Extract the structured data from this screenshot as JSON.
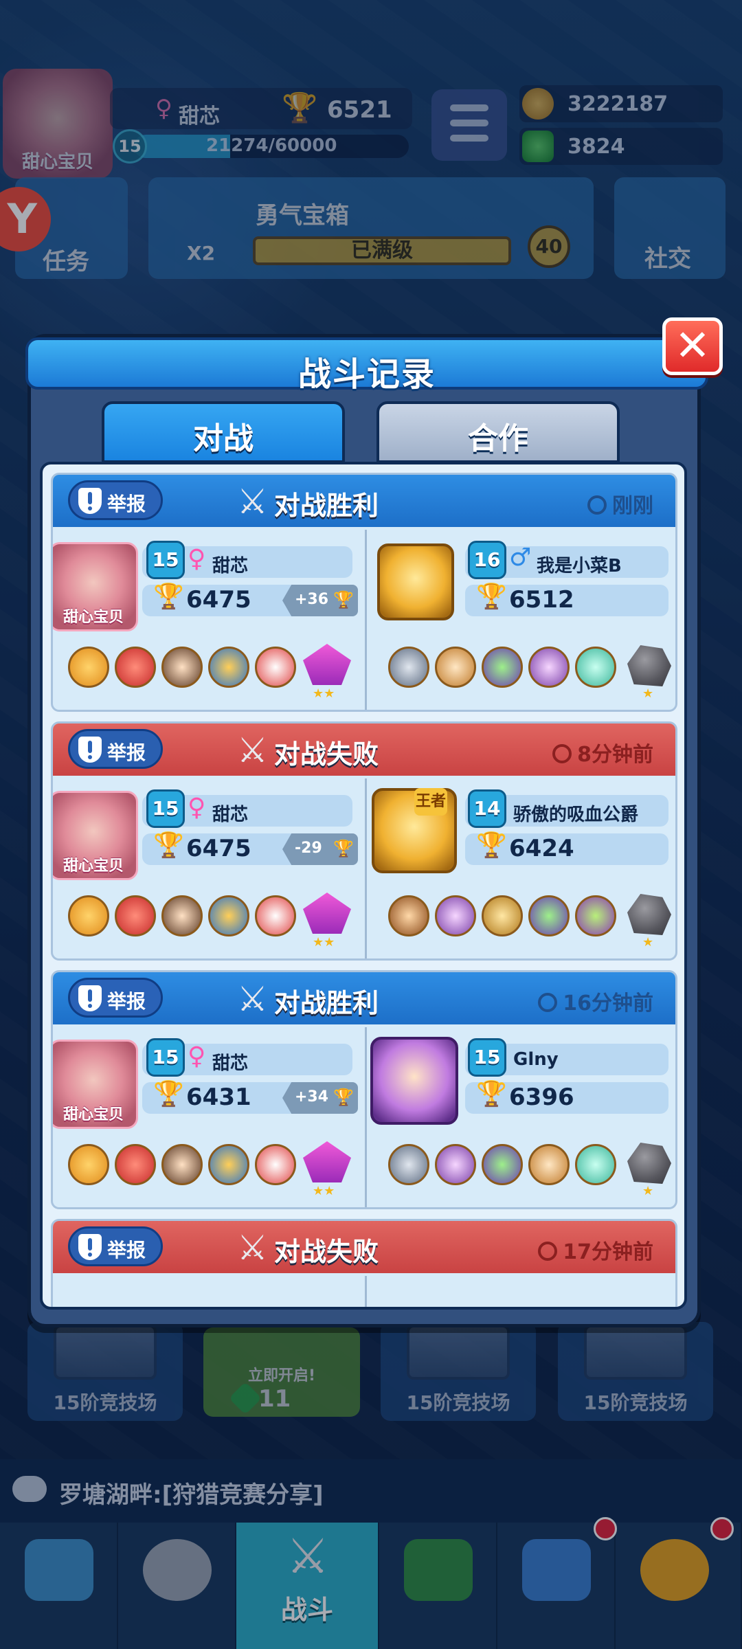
{
  "hud": {
    "avatar_tag": "甜心宝贝",
    "player_name": "甜芯",
    "trophies": "6521",
    "level": "15",
    "xp": "21274/60000",
    "gold": "3222187",
    "gems": "3824",
    "mission_label": "任务",
    "chest_title": "勇气宝箱",
    "chest_multiplier": "X2",
    "chest_status": "已满级",
    "chest_count": "40",
    "social_label": "社交",
    "logo": "Y"
  },
  "dialog": {
    "title": "战斗记录",
    "close_label": "✕",
    "tabs": [
      "对战",
      "合作"
    ]
  },
  "report_label": "举报",
  "records": [
    {
      "result": "对战胜利",
      "time": "刚刚",
      "me": {
        "avatar_tag": "甜心宝贝",
        "level": "15",
        "name": "甜芯",
        "score": "6475",
        "delta": "+36"
      },
      "opp": {
        "level": "16",
        "name": "我是小菜B",
        "score": "6512"
      }
    },
    {
      "result": "对战失败",
      "time": "8分钟前",
      "me": {
        "avatar_tag": "甜心宝贝",
        "level": "15",
        "name": "甜芯",
        "score": "6475",
        "delta": "-29"
      },
      "opp": {
        "level": "14",
        "name": "骄傲的吸血公爵",
        "score": "6424",
        "crown": "王者"
      }
    },
    {
      "result": "对战胜利",
      "time": "16分钟前",
      "me": {
        "avatar_tag": "甜心宝贝",
        "level": "15",
        "name": "甜芯",
        "score": "6431",
        "delta": "+34"
      },
      "opp": {
        "level": "15",
        "name": "Glny",
        "score": "6396"
      }
    },
    {
      "result": "对战失败",
      "time": "17分钟前"
    }
  ],
  "chests": [
    {
      "label": "15阶竞技场"
    },
    {
      "label": "立即开启!",
      "count": "11"
    },
    {
      "label": "15阶竞技场"
    },
    {
      "label": "15阶竞技场"
    }
  ],
  "ticker": "罗塘湖畔:[狩猎竞赛分享]",
  "nav": {
    "battle_label": "战斗"
  },
  "colors": {
    "win_header": "#2e8de3",
    "lose_header": "#e06560",
    "accent": "#2bb0c9"
  }
}
